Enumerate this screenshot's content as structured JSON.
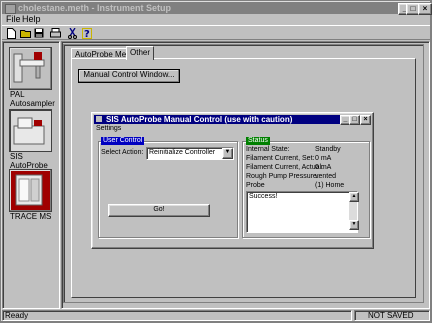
{
  "window": {
    "title": "cholestane.meth - Instrument Setup"
  },
  "menu": {
    "file": "File",
    "help": "Help"
  },
  "toolbar": {
    "buttons": [
      "new-icon",
      "open-icon",
      "save-icon",
      "print-icon",
      "cut-icon",
      "help-icon"
    ]
  },
  "instruments": [
    {
      "label": "PAL\nAutosampler",
      "line1": "PAL",
      "line2": "Autosampler"
    },
    {
      "label": "SIS AutoProbe"
    },
    {
      "label": "TRACE MS"
    }
  ],
  "tabs": {
    "autoprobe": "AutoProbe Method",
    "other": "Other"
  },
  "manual_control_button": "Manual Control Window...",
  "dialog": {
    "title": "SIS AutoProbe Manual Control (use with caution)",
    "menu_settings": "Settings",
    "user_control": {
      "label": "User Control",
      "select_action_label": "Select Action:",
      "select_action_value": "Reinitialize Controller",
      "go_button": "Go!"
    },
    "status": {
      "label": "Status",
      "rows": [
        {
          "name": "Internal State:",
          "value": "Standby"
        },
        {
          "name": "Filament Current, Set:",
          "value": "0 mA"
        },
        {
          "name": "Filament Current, Actual:",
          "value": "0 mA"
        },
        {
          "name": "Rough Pump Pressure:",
          "value": "vented"
        },
        {
          "name": "Probe",
          "value": "(1) Home"
        }
      ],
      "log": "Success!"
    }
  },
  "statusbar": {
    "left": "Ready",
    "right": "NOT SAVED"
  }
}
